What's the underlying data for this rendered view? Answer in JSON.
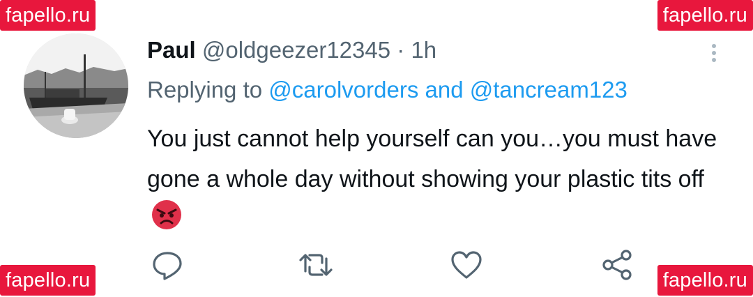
{
  "watermarks": {
    "top_left": "fapello.ru",
    "top_right": "fapello.ru",
    "bottom_left": "fapello.ru",
    "bottom_right": "fapello.ru"
  },
  "tweet": {
    "author_name": "Paul",
    "author_handle": "@oldgeezer12345",
    "separator": "·",
    "time": "1h",
    "replying_prefix": "Replying to",
    "mention_1": "@carolvorders",
    "mention_join": "and",
    "mention_2": "@tancream123",
    "text": "You just cannot help yourself can you…you must have gone a whole day without showing your plastic tits off",
    "emoji": "angry-face"
  },
  "actions": {
    "reply_icon": "reply-icon",
    "retweet_icon": "retweet-icon",
    "like_icon": "like-icon",
    "share_icon": "share-icon"
  },
  "colors": {
    "watermark_bg": "#e8173d",
    "mention": "#1d9bf0",
    "secondary_text": "#536471",
    "icon": "#536471",
    "emoji_face": "#e0304a"
  }
}
